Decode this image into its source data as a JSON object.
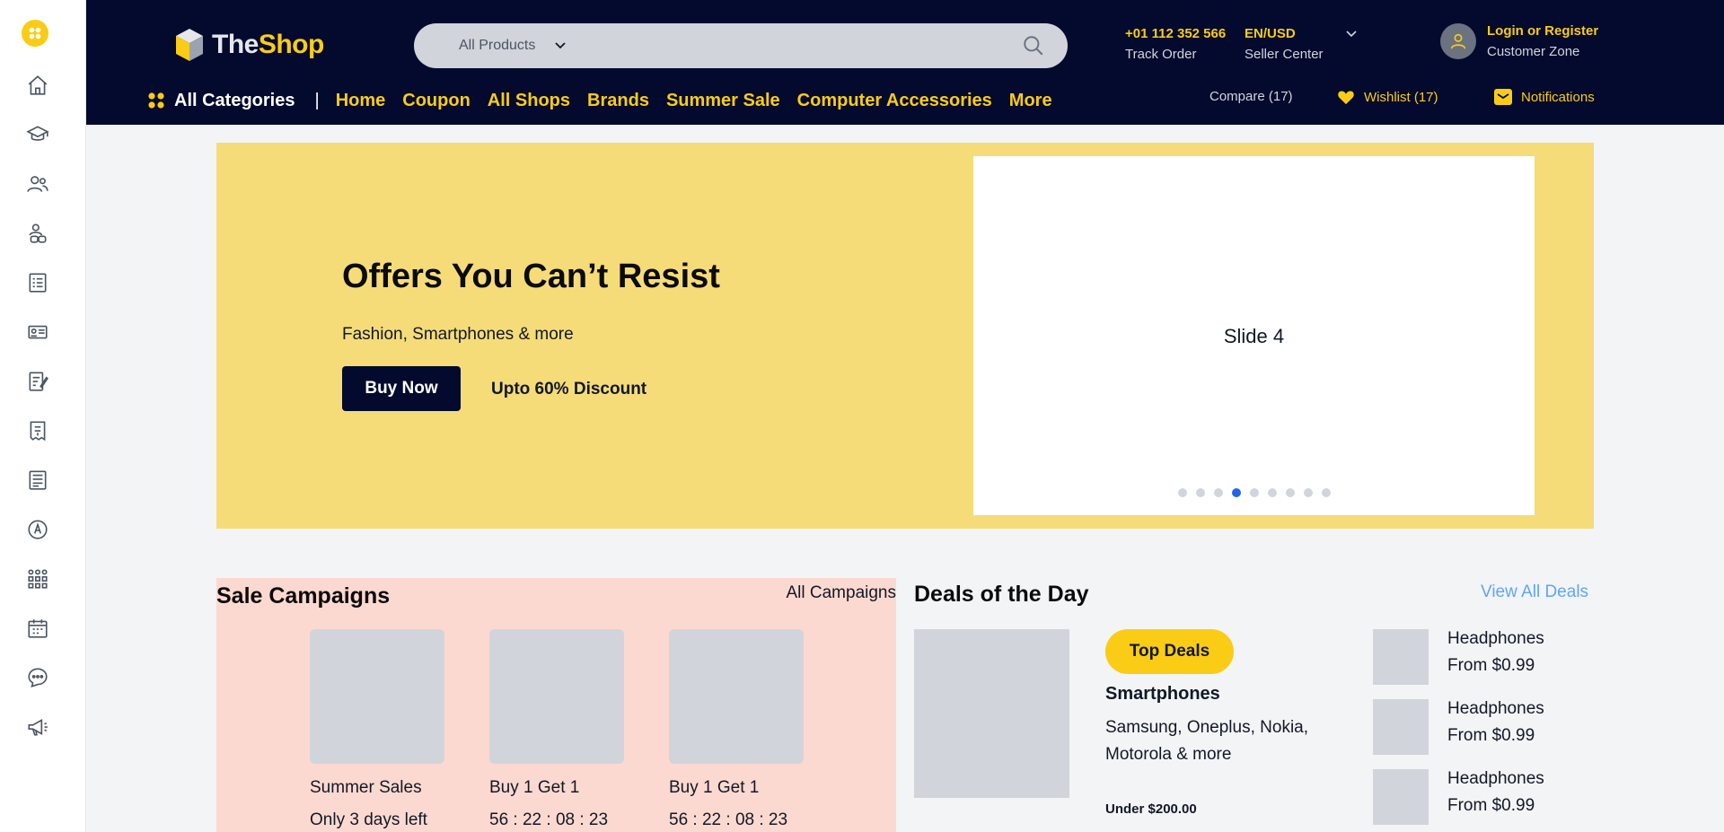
{
  "rail": {
    "icons": [
      "apps-icon",
      "home-icon",
      "graduation-cap-icon",
      "users-icon",
      "user-group-icon",
      "checklist-icon",
      "id-card-icon",
      "edit-note-icon",
      "receipt-icon",
      "document-icon",
      "award-icon",
      "org-chart-icon",
      "calendar-icon",
      "chat-icon",
      "megaphone-icon"
    ]
  },
  "header": {
    "logo_the": "The",
    "logo_shop": "Shop",
    "search": {
      "category": "All Products",
      "placeholder": ""
    },
    "phone": "+01 112 352 566",
    "track_order": "Track Order",
    "currency": "EN/USD",
    "seller_center": "Seller Center",
    "login": "Login or Register",
    "customer_zone": "Customer Zone",
    "colors": {
      "bg": "#030a2e",
      "accent": "#facc15"
    }
  },
  "nav": {
    "all_categories": "All Categories",
    "separator": "|",
    "links": [
      "Home",
      "Coupon",
      "All Shops",
      "Brands",
      "Summer Sale",
      "Computer Accessories",
      "More"
    ],
    "compare": "Compare (17)",
    "wishlist": "Wishlist (17)",
    "notifications": "Notifications"
  },
  "hero": {
    "title": "Offers You Can’t Resist",
    "subtitle": "Fashion, Smartphones & more",
    "button": "Buy Now",
    "discount": "Upto 60% Discount",
    "slide_label": "Slide 4",
    "slide_count": 9,
    "active_slide": 4,
    "bg_color": "#f5dc78"
  },
  "campaigns": {
    "title": "Sale Campaigns",
    "all_link": "All Campaigns",
    "items": [
      {
        "name": "Summer Sales",
        "time": "Only 3 days left"
      },
      {
        "name": "Buy 1 Get 1",
        "time": "56 : 22 : 08 : 23"
      },
      {
        "name": "Buy 1 Get 1",
        "time": "56 : 22 : 08 : 23"
      }
    ]
  },
  "deals": {
    "title": "Deals of the Day",
    "all_link": "View All Deals",
    "badge": "Top Deals",
    "name": "Smartphones",
    "desc": "Samsung, Oneplus, Nokia, Motorola & more",
    "price": "Under $200.00",
    "mini": [
      {
        "name": "Headphones",
        "price": "From $0.99"
      },
      {
        "name": "Headphones",
        "price": "From $0.99"
      },
      {
        "name": "Headphones",
        "price": "From $0.99"
      }
    ]
  }
}
